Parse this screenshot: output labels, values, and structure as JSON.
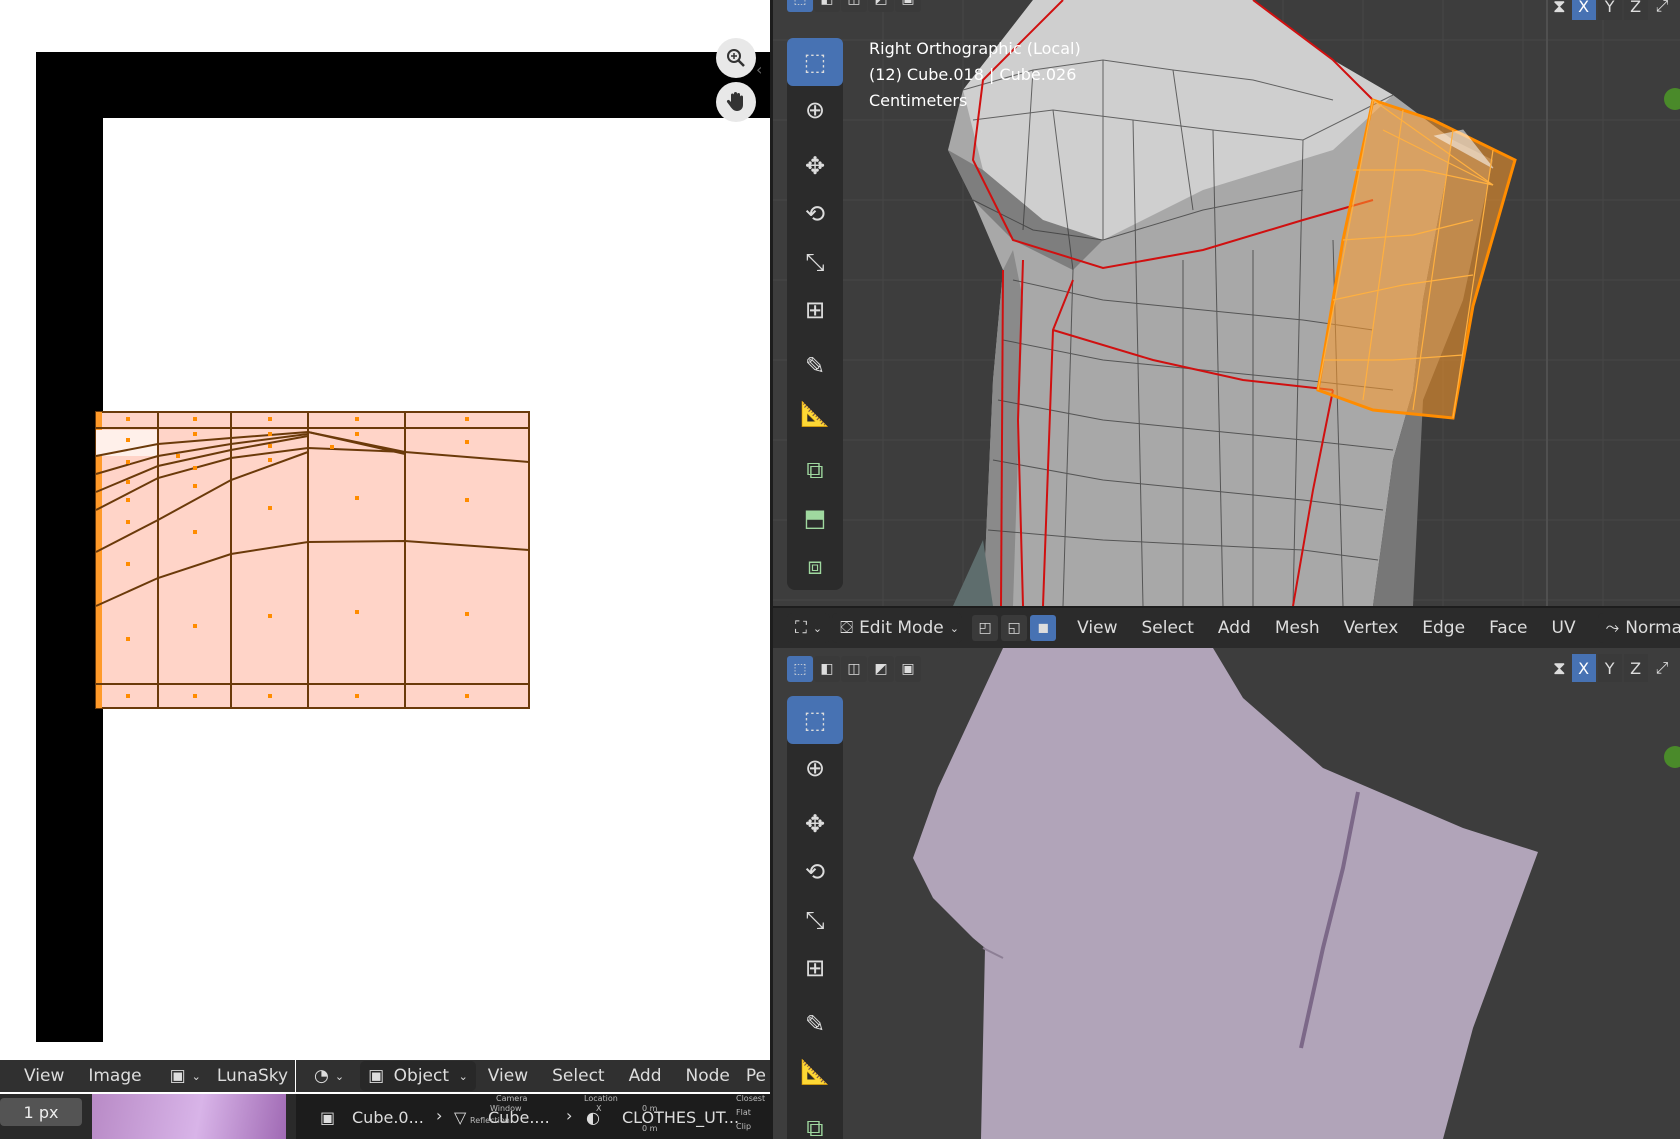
{
  "viewport_top": {
    "view_name": "Right Orthographic (Local)",
    "object_info": "(12) Cube.018 | Cube.026",
    "units": "Centimeters"
  },
  "edit_header": {
    "mode": "Edit Mode",
    "menus": [
      "View",
      "Select",
      "Add",
      "Mesh",
      "Vertex",
      "Edge",
      "Face",
      "UV"
    ],
    "orientation": "Normal"
  },
  "axes": [
    "X",
    "Y",
    "Z"
  ],
  "uv_header": {
    "menus": [
      "View",
      "Image"
    ],
    "image_name": "LunaSky"
  },
  "node_header": {
    "object_mode": "Object",
    "menus": [
      "View",
      "Select",
      "Add",
      "Node",
      "Pe"
    ]
  },
  "status_bar": {
    "px_value": "1 px",
    "breadcrumb": [
      "Cube.0...",
      "Cube....",
      "CLOTHES_UT..."
    ],
    "tiny_labels": [
      "Camera",
      "Window",
      "Reflection",
      "Location",
      "X",
      "0 m",
      "0 m",
      "Closest",
      "Flat",
      "Clip"
    ]
  },
  "colors": {
    "uv_face": "#ffd4c8",
    "uv_edge": "#6b3a0a",
    "uv_vertex": "#ff8c00",
    "selection_orange": "#ff9a2a",
    "seam_red": "#d01010",
    "active_blue": "#4772b3",
    "mesh_lilac": "#b1a4b9"
  },
  "icons": {
    "zoom": "magnify-plus-icon",
    "pan": "hand-icon",
    "tools": [
      "select-box-icon",
      "cursor-icon",
      "move-icon",
      "rotate-icon",
      "scale-icon",
      "transform-icon",
      "annotate-icon",
      "measure-icon",
      "add-cube-icon",
      "extrude-icon",
      "inset-icon"
    ]
  }
}
